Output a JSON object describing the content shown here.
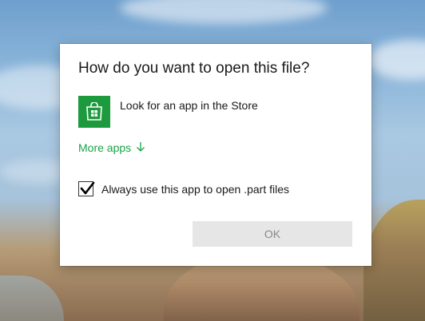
{
  "dialog": {
    "title": "How do you want to open this file?",
    "store_option": {
      "label": "Look for an app in the Store",
      "icon": "store-bag-icon",
      "tile_color": "#1e9a3e"
    },
    "more_apps": {
      "label": "More apps",
      "icon": "arrow-down-icon",
      "color": "#17a346"
    },
    "always_use": {
      "label": "Always use this app to open .part files",
      "checked": true
    },
    "ok_button": {
      "label": "OK",
      "enabled": false
    }
  }
}
